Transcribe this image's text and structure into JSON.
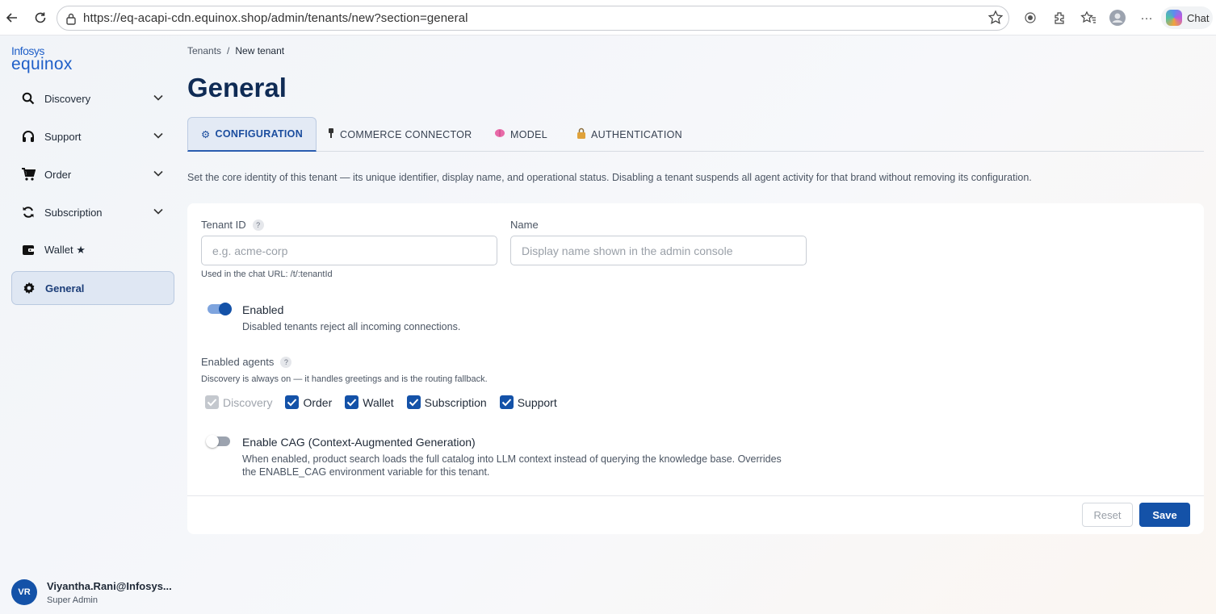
{
  "browser": {
    "url": "https://eq-acapi-cdn.equinox.shop/admin/tenants/new?section=general",
    "chat_label": "Chat",
    "more_label": "···"
  },
  "logo": {
    "top": "Infosys",
    "bottom": "equinox"
  },
  "sidebar": {
    "items": [
      {
        "label": "Discovery",
        "icon": "search-icon"
      },
      {
        "label": "Support",
        "icon": "headset-icon"
      },
      {
        "label": "Order",
        "icon": "cart-icon"
      },
      {
        "label": "Subscription",
        "icon": "refresh-icon"
      },
      {
        "label": "Wallet ★",
        "icon": "wallet-icon"
      },
      {
        "label": "General",
        "icon": "gear-icon",
        "active": true
      }
    ]
  },
  "user": {
    "initials": "VR",
    "name": "Viyantha.Rani@Infosys...",
    "role": "Super Admin"
  },
  "breadcrumb": {
    "parent": "Tenants",
    "separator": "/",
    "current": "New tenant"
  },
  "page": {
    "title": "General"
  },
  "tabs": [
    {
      "label": "CONFIGURATION",
      "icon": "⚙",
      "active": true
    },
    {
      "label": "COMMERCE CONNECTOR",
      "icon": "plug-icon"
    },
    {
      "label": "MODEL",
      "icon": "brain-icon"
    },
    {
      "label": "AUTHENTICATION",
      "icon": "lock-icon"
    }
  ],
  "description": "Set the core identity of this tenant — its unique identifier, display name, and operational status. Disabling a tenant suspends all agent activity for that brand without removing its configuration.",
  "form": {
    "tenant_id": {
      "label": "Tenant ID",
      "help": "?",
      "value": "",
      "placeholder": "e.g. acme-corp",
      "hint": "Used in the chat URL: /t/:tenantId"
    },
    "name": {
      "label": "Name",
      "value": "",
      "placeholder": "Display name shown in the admin console"
    },
    "enabled": {
      "label": "Enabled",
      "description": "Disabled tenants reject all incoming connections.",
      "on": true
    },
    "agents": {
      "label": "Enabled agents",
      "help": "?",
      "hint": "Discovery is always on — it handles greetings and is the routing fallback.",
      "options": [
        {
          "label": "Discovery",
          "checked": true,
          "disabled": true
        },
        {
          "label": "Order",
          "checked": true
        },
        {
          "label": "Wallet",
          "checked": true
        },
        {
          "label": "Subscription",
          "checked": true
        },
        {
          "label": "Support",
          "checked": true
        }
      ]
    },
    "cag": {
      "label": "Enable CAG (Context-Augmented Generation)",
      "description_line1": "When enabled, product search loads the full catalog into LLM context instead of querying the knowledge base. Overrides",
      "description_line2": "the ENABLE_CAG environment variable for this tenant.",
      "on": false
    }
  },
  "actions": {
    "reset": "Reset",
    "save": "Save"
  },
  "colors": {
    "brand": "#1452a8",
    "title": "#0f2b55",
    "active_tab": "#1b4d9e"
  }
}
